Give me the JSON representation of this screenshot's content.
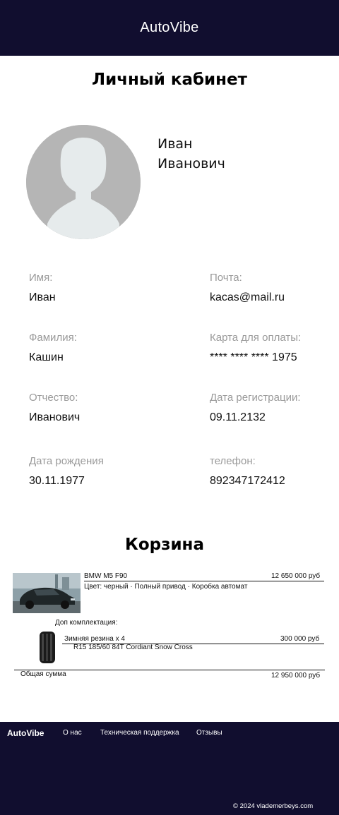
{
  "header": {
    "brand": "AutoVibe"
  },
  "page_title": "Личный кабинет",
  "profile": {
    "first_name": "Иван",
    "middle_name": "Иванович"
  },
  "fields": {
    "name": {
      "label": "Имя:",
      "value": "Иван"
    },
    "email": {
      "label": "Почта:",
      "value": "kacas@mail.ru"
    },
    "surname": {
      "label": "Фамилия:",
      "value": "Кашин"
    },
    "card": {
      "label": "Карта для оплаты:",
      "value": "**** **** **** 1975"
    },
    "patronymic": {
      "label": "Отчество:",
      "value": "Иванович"
    },
    "reg_date": {
      "label": "Дата регистрации:",
      "value": "09.11.2132"
    },
    "birth_date": {
      "label": "Дата рождения",
      "value": "30.11.1977"
    },
    "phone": {
      "label": "телефон:",
      "value": "892347172412"
    }
  },
  "cart": {
    "title": "Корзина",
    "item": {
      "name": "BMW M5 F90",
      "price": "12 650 000 руб",
      "specs": "Цвет: черный · Полный привод · Коробка автомат"
    },
    "extras_label": "Доп комплектация:",
    "extra": {
      "name": "Зимняя резина х 4",
      "price": "300 000 руб",
      "desc": "R15 185/60 84T Cordiant Snow Cross"
    },
    "total_label": "Общая сумма",
    "total_value": "12 950 000 руб"
  },
  "footer": {
    "brand": "AutoVibe",
    "links": [
      "О нас",
      "Техническая поддержка",
      "Отзывы"
    ],
    "copyright": "© 2024 vlademerbeys.com"
  },
  "colors": {
    "navy": "#110e2f",
    "label_gray": "#9a9a9a",
    "avatar_gray": "#b5b5b5"
  }
}
